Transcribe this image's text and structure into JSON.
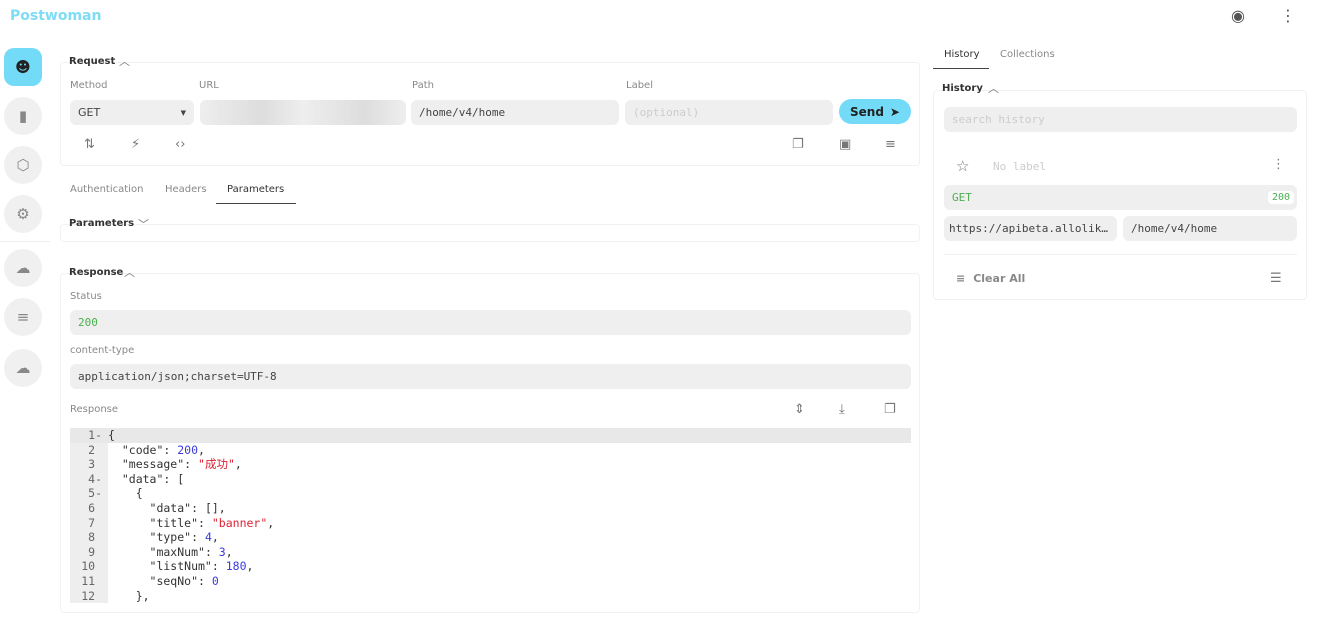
{
  "app": {
    "title": "Postwoman",
    "github_icon": "github-icon",
    "menu_icon": "more-vert-icon"
  },
  "sidebar": {
    "items": [
      {
        "name": "sidebar-item-rest",
        "icon": "alien-icon",
        "active": true
      },
      {
        "name": "sidebar-item-realtime",
        "icon": "plug-icon"
      },
      {
        "name": "sidebar-item-graphql",
        "icon": "graphql-icon"
      },
      {
        "name": "sidebar-item-settings",
        "icon": "gear-icon"
      },
      {
        "name": "sidebar-item-cloud",
        "icon": "cloud-icon"
      },
      {
        "name": "sidebar-item-docs",
        "icon": "list-icon"
      },
      {
        "name": "sidebar-item-cloud2",
        "icon": "cloud-icon"
      }
    ]
  },
  "request": {
    "title": "Request",
    "method_label": "Method",
    "method": "GET",
    "url_label": "URL",
    "url": "",
    "path_label": "Path",
    "path": "/home/v4/home",
    "label_label": "Label",
    "label_placeholder": "(optional)",
    "send": "Send",
    "accent": "#73dbf7"
  },
  "tabs": [
    "Authentication",
    "Headers",
    "Parameters"
  ],
  "active_tab": "Parameters",
  "parameters": {
    "title": "Parameters"
  },
  "response": {
    "title": "Response",
    "status_label": "Status",
    "status": "200",
    "ct_label": "content-type",
    "content_type": "application/json;charset=UTF-8",
    "body_label": "Response",
    "lines": [
      [
        [
          "p",
          "{"
        ]
      ],
      [
        [
          "k",
          "  \"code\""
        ],
        [
          "p",
          ": "
        ],
        [
          "n",
          "200"
        ],
        [
          "p",
          ","
        ]
      ],
      [
        [
          "k",
          "  \"message\""
        ],
        [
          "p",
          ": "
        ],
        [
          "s",
          "\"成功\""
        ],
        [
          "p",
          ","
        ]
      ],
      [
        [
          "k",
          "  \"data\""
        ],
        [
          "p",
          ": ["
        ]
      ],
      [
        [
          "p",
          "    {"
        ]
      ],
      [
        [
          "k",
          "      \"data\""
        ],
        [
          "p",
          ": [],"
        ]
      ],
      [
        [
          "k",
          "      \"title\""
        ],
        [
          "p",
          ": "
        ],
        [
          "s",
          "\"banner\""
        ],
        [
          "p",
          ","
        ]
      ],
      [
        [
          "k",
          "      \"type\""
        ],
        [
          "p",
          ": "
        ],
        [
          "n",
          "4"
        ],
        [
          "p",
          ","
        ]
      ],
      [
        [
          "k",
          "      \"maxNum\""
        ],
        [
          "p",
          ": "
        ],
        [
          "n",
          "3"
        ],
        [
          "p",
          ","
        ]
      ],
      [
        [
          "k",
          "      \"listNum\""
        ],
        [
          "p",
          ": "
        ],
        [
          "n",
          "180"
        ],
        [
          "p",
          ","
        ]
      ],
      [
        [
          "k",
          "      \"seqNo\""
        ],
        [
          "p",
          ": "
        ],
        [
          "n",
          "0"
        ]
      ],
      [
        [
          "p",
          "    },"
        ]
      ]
    ],
    "folds": [
      1,
      4,
      5
    ]
  },
  "history": {
    "tabs": [
      "History",
      "Collections"
    ],
    "title": "History",
    "search_placeholder": "search history",
    "entry": {
      "label": "No label",
      "method": "GET",
      "status": "200",
      "url": "https://apibeta.allolik…",
      "path": "/home/v4/home"
    },
    "clear_all": "Clear All",
    "status_color": "#4caf50"
  }
}
